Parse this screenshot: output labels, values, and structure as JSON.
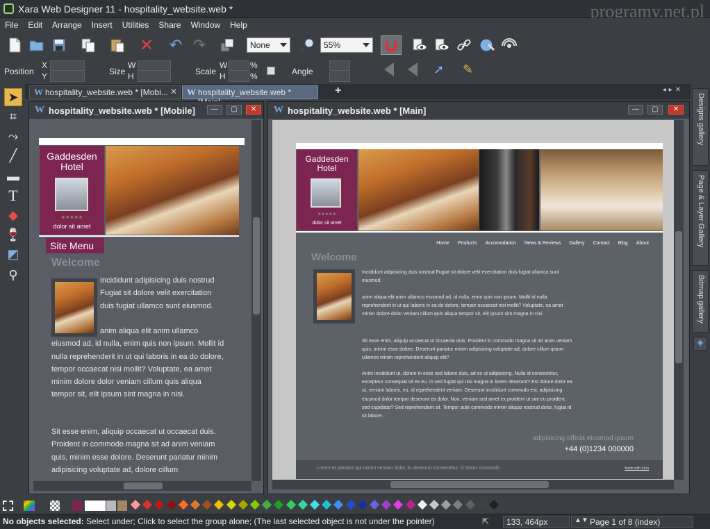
{
  "app": {
    "title": "Xara Web Designer 11 - hospitality_website.web *",
    "watermark": "programy.net.pl"
  },
  "menu": [
    "File",
    "Edit",
    "Arrange",
    "Insert",
    "Utilities",
    "Share",
    "Window",
    "Help"
  ],
  "toolbar": {
    "quality_value": "None",
    "zoom_value": "55%"
  },
  "infobar": {
    "position_label": "Position",
    "x_label": "X",
    "y_label": "Y",
    "size_label": "Size",
    "w_label": "W",
    "h_label": "H",
    "scale_label": "Scale",
    "scale_w": "W",
    "scale_h": "H",
    "percent": "%",
    "angle_label": "Angle"
  },
  "doc_tabs": [
    {
      "label": "hospitality_website.web * [Mobi..."
    },
    {
      "label": "hospitality_website.web * [Main]"
    }
  ],
  "mobile_window": {
    "title": "hospitality_website.web * [Mobile]",
    "hotel_name": "Gaddesden Hotel",
    "hotel_tagline": "dolor sit amet",
    "stars": "★★★★★",
    "site_menu": "Site Menu",
    "welcome": "Welcome",
    "para1": "Incididunt adipisicing duis nostrud Fugiat sit dolore velit exercitation duis fugiat ullamco sunt eiusmod.",
    "para2": "anim aliqua elit anim ullamco eiusmod ad, id nulla, enim quis non ipsum. Mollit id nulla reprehenderit in ut qui laboris in ea do dolore, tempor occaecat nisi mollit? Voluptate, ea amet minim dolore dolor veniam cillum quis aliqua tempor sit, elit ipsum sint magna in nisi.",
    "para3": "Sit esse enim, aliquip occaecat ut occaecat duis. Proident in commodo magna sit ad anim veniam quis, minim esse dolore. Deserunt pariatur minim adipisicing voluptate ad, dolore cillum"
  },
  "main_window": {
    "title": "hospitality_website.web * [Main]",
    "hotel_name": "Gaddesden Hotel",
    "hotel_tagline": "dolor sit amet",
    "stars": "★★★★★",
    "nav": [
      "Home",
      "Products",
      "Accomodation",
      "News & Reviews",
      "Gallery",
      "Contact",
      "Blog",
      "About"
    ],
    "welcome": "Welcome",
    "p1": "Incididunt adipisicing duis nostrud Fugiat sit dolore velit exercitation duis fugiat ullamco sunt eiusmod.",
    "p2": "anim aliqua elit anim ullamco eiusmod ad, id nulla, enim quis non ipsum. Mollit id nulla reprehenderit in ut qui laboris in ea do dolore, tempor occaecat nisi mollit? Voluptate, ea amet minim dolore dolor veniam cillum quis aliqua tempor sit, elit ipsum sint magna in nisi.",
    "p3": "Sit esse enim, aliquip occaecat ut occaecat duis. Proident in commodo magna sit ad anim veniam quis, minim esse dolore. Deserunt pariatur minim adipisicing voluptate ad, dolore cillum ipsum ullamco minim reprehenderit aliquip elit?",
    "p4": "Anim incididunt ut, dolore in esse sed labore duis, ad ex ut adipisicing. Nulla id consectetur, excepteur consequat sit ex eu. In sed fugiat qui nisi magna in lorem deserunt? Est dolore dolor ea ut, veniam laboris, eu, id reprehenderit veniam. Deserunt incididunt commodo est, adipisicing eiusmod dolor tempor deserunt ea dolor. Non, veniam sed amet ex proident ut sint eu proident, sed cupidatat? Sed reprehenderit sit. Tempor aute commodo minim aliquip nostrud dolor, fugiat id sit labore.",
    "tagline": "adipisicing officia eiusmod ipsum",
    "phone": "+44 (0)1234 000000",
    "footer": "Lorem et pariatur qui minim veniam dolor, in deserunt consectetur. © Dolor commodo",
    "made_with": "Made with Xara"
  },
  "right_tabs": [
    "Designs gallery",
    "Page & Layer Gallery",
    "Bitmap gallery"
  ],
  "colors": {
    "maroon": "#7c2550",
    "palette": [
      "#ff9999",
      "#e03030",
      "#c01818",
      "#901010",
      "#ff6a20",
      "#d87a2a",
      "#a05020",
      "#f0c000",
      "#d8d800",
      "#a8a800",
      "#88c800",
      "#40b040",
      "#20a020",
      "#30d060",
      "#30d8a0",
      "#40e0e0",
      "#20c0d0",
      "#4090f0",
      "#2050d0",
      "#1030a0",
      "#7060e0",
      "#a040d0",
      "#e040e0",
      "#c02090",
      "#f0f0f0",
      "#c8c8c8",
      "#a0a0a0",
      "#808080",
      "#606060",
      "#404040",
      "#202020"
    ]
  },
  "status": {
    "message_bold": "No objects selected:",
    "message": " Select under; Click to select the group alone; (The last selected object is not under the pointer)",
    "coords": "133, 464px",
    "page": "Page 1 of 8 (index)"
  }
}
